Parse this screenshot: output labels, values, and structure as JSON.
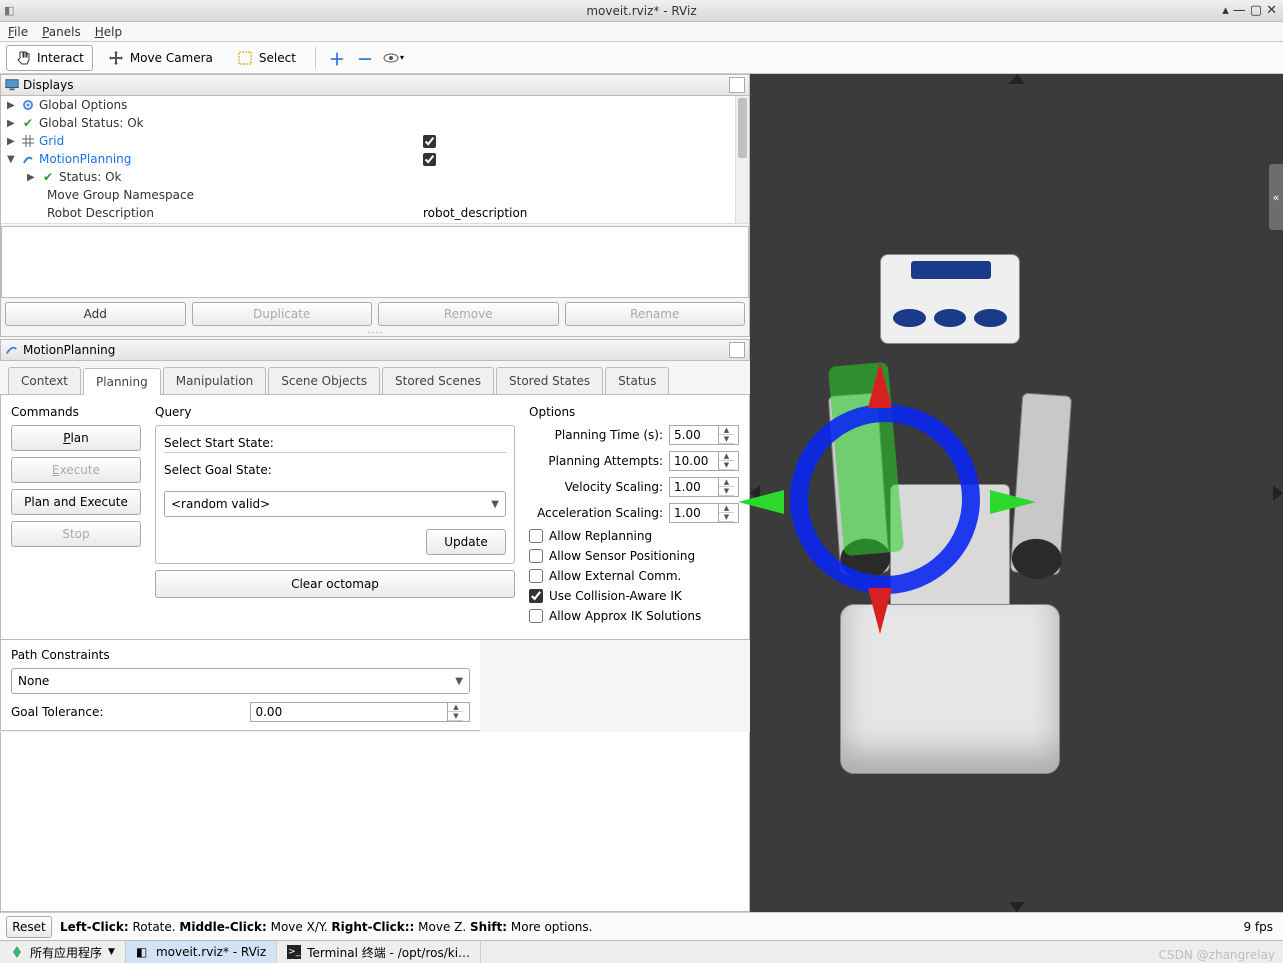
{
  "window": {
    "title": "moveit.rviz* - RViz"
  },
  "menu": {
    "file": "File",
    "panels": "Panels",
    "help": "Help"
  },
  "toolbar": {
    "interact": "Interact",
    "move_camera": "Move Camera",
    "select": "Select"
  },
  "displays_panel": {
    "title": "Displays",
    "items": {
      "global_options": "Global Options",
      "global_status": "Global Status: Ok",
      "grid": "Grid",
      "motion_planning": "MotionPlanning",
      "status_ok": "Status: Ok",
      "move_group_ns": "Move Group Namespace",
      "robot_desc_label": "Robot Description",
      "robot_desc_value": "robot_description"
    },
    "buttons": {
      "add": "Add",
      "duplicate": "Duplicate",
      "remove": "Remove",
      "rename": "Rename"
    }
  },
  "mp_panel_title": "MotionPlanning",
  "tabs": {
    "context": "Context",
    "planning": "Planning",
    "manipulation": "Manipulation",
    "scene_objects": "Scene Objects",
    "stored_scenes": "Stored Scenes",
    "stored_states": "Stored States",
    "status": "Status"
  },
  "commands": {
    "label": "Commands",
    "plan": "Plan",
    "execute": "Execute",
    "plan_execute": "Plan and Execute",
    "stop": "Stop"
  },
  "query": {
    "label": "Query",
    "select_start": "Select Start State:",
    "select_goal": "Select Goal State:",
    "random_valid": "<random valid>",
    "update": "Update",
    "clear_octomap": "Clear octomap"
  },
  "options": {
    "label": "Options",
    "planning_time": "Planning Time (s):",
    "planning_time_val": "5.00",
    "planning_attempts": "Planning Attempts:",
    "planning_attempts_val": "10.00",
    "velocity_scaling": "Velocity Scaling:",
    "velocity_scaling_val": "1.00",
    "accel_scaling": "Acceleration Scaling:",
    "accel_scaling_val": "1.00",
    "allow_replanning": "Allow Replanning",
    "allow_sensor": "Allow Sensor Positioning",
    "allow_external": "Allow External Comm.",
    "collision_ik": "Use Collision-Aware IK",
    "approx_ik": "Allow Approx IK Solutions"
  },
  "path_constraints": {
    "label": "Path Constraints",
    "none": "None",
    "goal_tolerance": "Goal Tolerance:",
    "goal_tolerance_val": "0.00"
  },
  "status": {
    "reset": "Reset",
    "hints_left": "Left-Click:",
    "hints_left_t": " Rotate. ",
    "hints_mid": "Middle-Click:",
    "hints_mid_t": " Move X/Y. ",
    "hints_right": "Right-Click::",
    "hints_right_t": " Move Z. ",
    "hints_shift": "Shift:",
    "hints_shift_t": " More options.",
    "fps": "9 fps"
  },
  "taskbar": {
    "all_apps": "所有应用程序",
    "rviz": "moveit.rviz* - RViz",
    "terminal": "Terminal 终端 - /opt/ros/ki…"
  },
  "watermark": "CSDN @zhangrelay"
}
